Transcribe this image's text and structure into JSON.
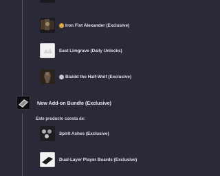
{
  "items": [
    {
      "label": "Iron Fist Alexander (Exclusive)",
      "icon": "fist-emoji-icon"
    },
    {
      "label": "East Limgrave (Daily Unlocks)",
      "icon": ""
    },
    {
      "label": "Blaidd the Half-Wolf (Exclusive)",
      "icon": "wolf-emoji-icon"
    }
  ],
  "bundle": {
    "title": "New Add-on Bundle (Exclusive)",
    "consists_label": "Este producto consta de:",
    "contents": [
      {
        "label": "Spirit Ashes (Exclusive)"
      },
      {
        "label": "Dual-Layer Player Boards (Exclusive)"
      }
    ]
  },
  "colors": {
    "background": "#2b2838",
    "text": "#e6e2ee",
    "tree_line": "#5a5566"
  }
}
